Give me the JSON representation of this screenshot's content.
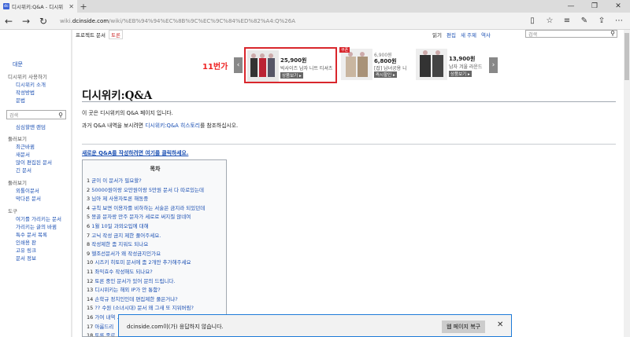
{
  "tab": {
    "title": "디시위키:Q&A - 디시위",
    "favicon": "dc",
    "close": "✕",
    "new_tab": "+"
  },
  "window": {
    "minimize": "—",
    "maximize": "❐",
    "close": "✕"
  },
  "nav": {
    "url_prefix": "wiki.",
    "url_domain": "dcinside.com",
    "url_path": "/wiki/%EB%94%94%EC%8B%9C%EC%9C%84%ED%82%A4:Q%26A"
  },
  "topbar": {
    "project": "프로젝트 문서",
    "discussion": "토론",
    "actions": [
      "읽기",
      "편집",
      "새 주제",
      "역사"
    ],
    "search_placeholder": "검색"
  },
  "sidebar": {
    "main": "대문",
    "group1_label": "디시위키 사용하기",
    "group1": [
      "디시위키 소개",
      "작성방법",
      "문법"
    ],
    "search_placeholder": "검색",
    "after_search": [
      "심심할땐 랜덤"
    ],
    "group2_label": "둘러보기",
    "group2": [
      "최근바뀜",
      "새문서",
      "많이 편집된 문서",
      "긴 문서"
    ],
    "group3_label": "둘러보기",
    "group3": [
      "외톨이문서",
      "막다른 문서"
    ],
    "group4_label": "도구",
    "group4": [
      "여기를 가리키는 문서",
      "가리키는 글의 바뀜",
      "특수 문서 목록",
      "인쇄용 판",
      "고유 링크",
      "문서 정보"
    ]
  },
  "ad": {
    "logo": "11번가",
    "items": [
      {
        "price": "25,900원",
        "name": "빅사이즈 남자 니트 티셔츠",
        "button": "상품보기 ▸"
      },
      {
        "badge": "쿠폰",
        "old_price": "6,900원",
        "price": "6,800원",
        "name": "[잡] 남녀공용 니",
        "button": "즉시할인 ▸"
      },
      {
        "price": "13,900원",
        "name": "남자 겨울 라운드",
        "button": "상품보기 ▸"
      }
    ]
  },
  "page": {
    "title": "디시위키:Q&A",
    "intro": "이 곳은 디시위키의 Q&A 페이지 입니다.",
    "history_pre": "과거 Q&A 내역을 보시려면 ",
    "history_link": "디시위키:Q&A 히스토리",
    "history_post": "를 참조하십시오.",
    "new_link": "새로운 Q&A를 작성하려면 여기를 클릭하세요."
  },
  "toc": {
    "title": "목차",
    "items": [
      {
        "num": "1",
        "text": "굳이 이 문서가 필요할?"
      },
      {
        "num": "2",
        "text": "50000원이랑 오만원이랑 5만원 문서 다 따로있는데"
      },
      {
        "num": "3",
        "text": "님아 제 사용자토론 해동중"
      },
      {
        "num": "4",
        "text": "규칙 보면 이용자를 비하하는 서술은 금지라 되있던데"
      },
      {
        "num": "5",
        "text": "몽골 문자랑 만주 문자가 세로로 써지질 않네여"
      },
      {
        "num": "6",
        "text": "1월 10일 과외오입에 대해"
      },
      {
        "num": "7",
        "text": "고닉 작성 금지 제한 풀어주세요."
      },
      {
        "num": "8",
        "text": "작성제한 좀 지워도 되나요"
      },
      {
        "num": "9",
        "text": "헬조선문서가 왜 작성금지인가요"
      },
      {
        "num": "10",
        "text": "시즈키 히토미 문서에 좀 2개만 추가해주세요"
      },
      {
        "num": "11",
        "text": "좌익효수 작성해도 되나요?"
      },
      {
        "num": "12",
        "text": "토론 중인 문서가 있어 문의 드립니다."
      },
      {
        "num": "13",
        "text": "디시위키는 해외 IP가 안 통함?"
      },
      {
        "num": "14",
        "text": "손학규 정치인인데 편집제한 풀은거냐?"
      },
      {
        "num": "15",
        "text": "?? 수원 (소녀시대) 문서 왜 그새 또 지워버림?"
      },
      {
        "num": "16",
        "text": "가여 내역 ... 살았한거"
      },
      {
        "num": "17",
        "text": "아룸드리"
      },
      {
        "num": "18",
        "text": "토론 종료"
      }
    ]
  },
  "notification": {
    "domain": "dcinside.com",
    "message": "이(가) 응답하지 않습니다.",
    "button": "웹 페이지 복구",
    "close": "✕"
  }
}
